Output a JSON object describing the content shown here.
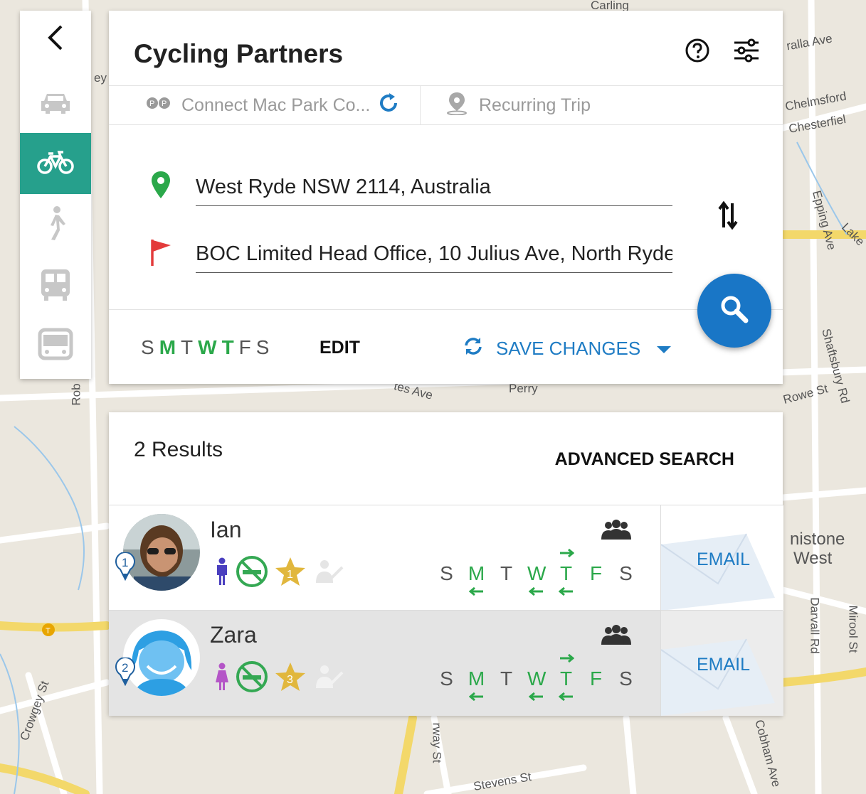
{
  "map": {
    "labels": [
      "Carling",
      "ralla Ave",
      "Chelmsford",
      "Chesterfiel",
      "Epping Ave",
      "Lake",
      "Shaftsbury Rd",
      "Rowe St",
      "nistone",
      "West",
      "Darvall Rd",
      "Mirool St",
      "Cobham Ave",
      "Stevens St",
      "rway St",
      "Crowgey St",
      "Rob",
      "tes Ave",
      "Perry",
      "ey",
      "Rd"
    ]
  },
  "mode_rail": {
    "items": [
      {
        "name": "back",
        "icon": "chevron-left-icon"
      },
      {
        "name": "car",
        "icon": "car-icon"
      },
      {
        "name": "bicycle",
        "icon": "bicycle-icon",
        "active": true
      },
      {
        "name": "walk",
        "icon": "walking-icon"
      },
      {
        "name": "bus",
        "icon": "bus-icon"
      },
      {
        "name": "coach",
        "icon": "coach-icon"
      }
    ],
    "active_color": "#26a08c"
  },
  "search_panel": {
    "title": "Cycling Partners",
    "connect_label": "Connect Mac Park Co...",
    "recurring_label": "Recurring Trip",
    "origin_value": "West Ryde NSW 2114, Australia",
    "destination_value": "BOC Limited Head Office, 10 Julius Ave, North Ryde",
    "days": [
      {
        "letter": "S",
        "on": false
      },
      {
        "letter": "M",
        "on": true
      },
      {
        "letter": "T",
        "on": false
      },
      {
        "letter": "W",
        "on": true
      },
      {
        "letter": "T",
        "on": true
      },
      {
        "letter": "F",
        "on": false
      },
      {
        "letter": "S",
        "on": false
      }
    ],
    "edit_label": "EDIT",
    "save_label": "SAVE CHANGES",
    "accent": "#1f7cc4",
    "green": "#2ba84a"
  },
  "results": {
    "count_label": "2 Results",
    "advanced_search_label": "ADVANCED SEARCH",
    "items": [
      {
        "rank": "1",
        "name": "Ian",
        "gender": "male",
        "rating": "1",
        "email_label": "EMAIL",
        "week": [
          "S",
          "M",
          "T",
          "W",
          "T",
          "F",
          "S"
        ]
      },
      {
        "rank": "2",
        "name": "Zara",
        "gender": "female",
        "rating": "3",
        "email_label": "EMAIL",
        "week": [
          "S",
          "M",
          "T",
          "W",
          "T",
          "F",
          "S"
        ]
      }
    ]
  }
}
